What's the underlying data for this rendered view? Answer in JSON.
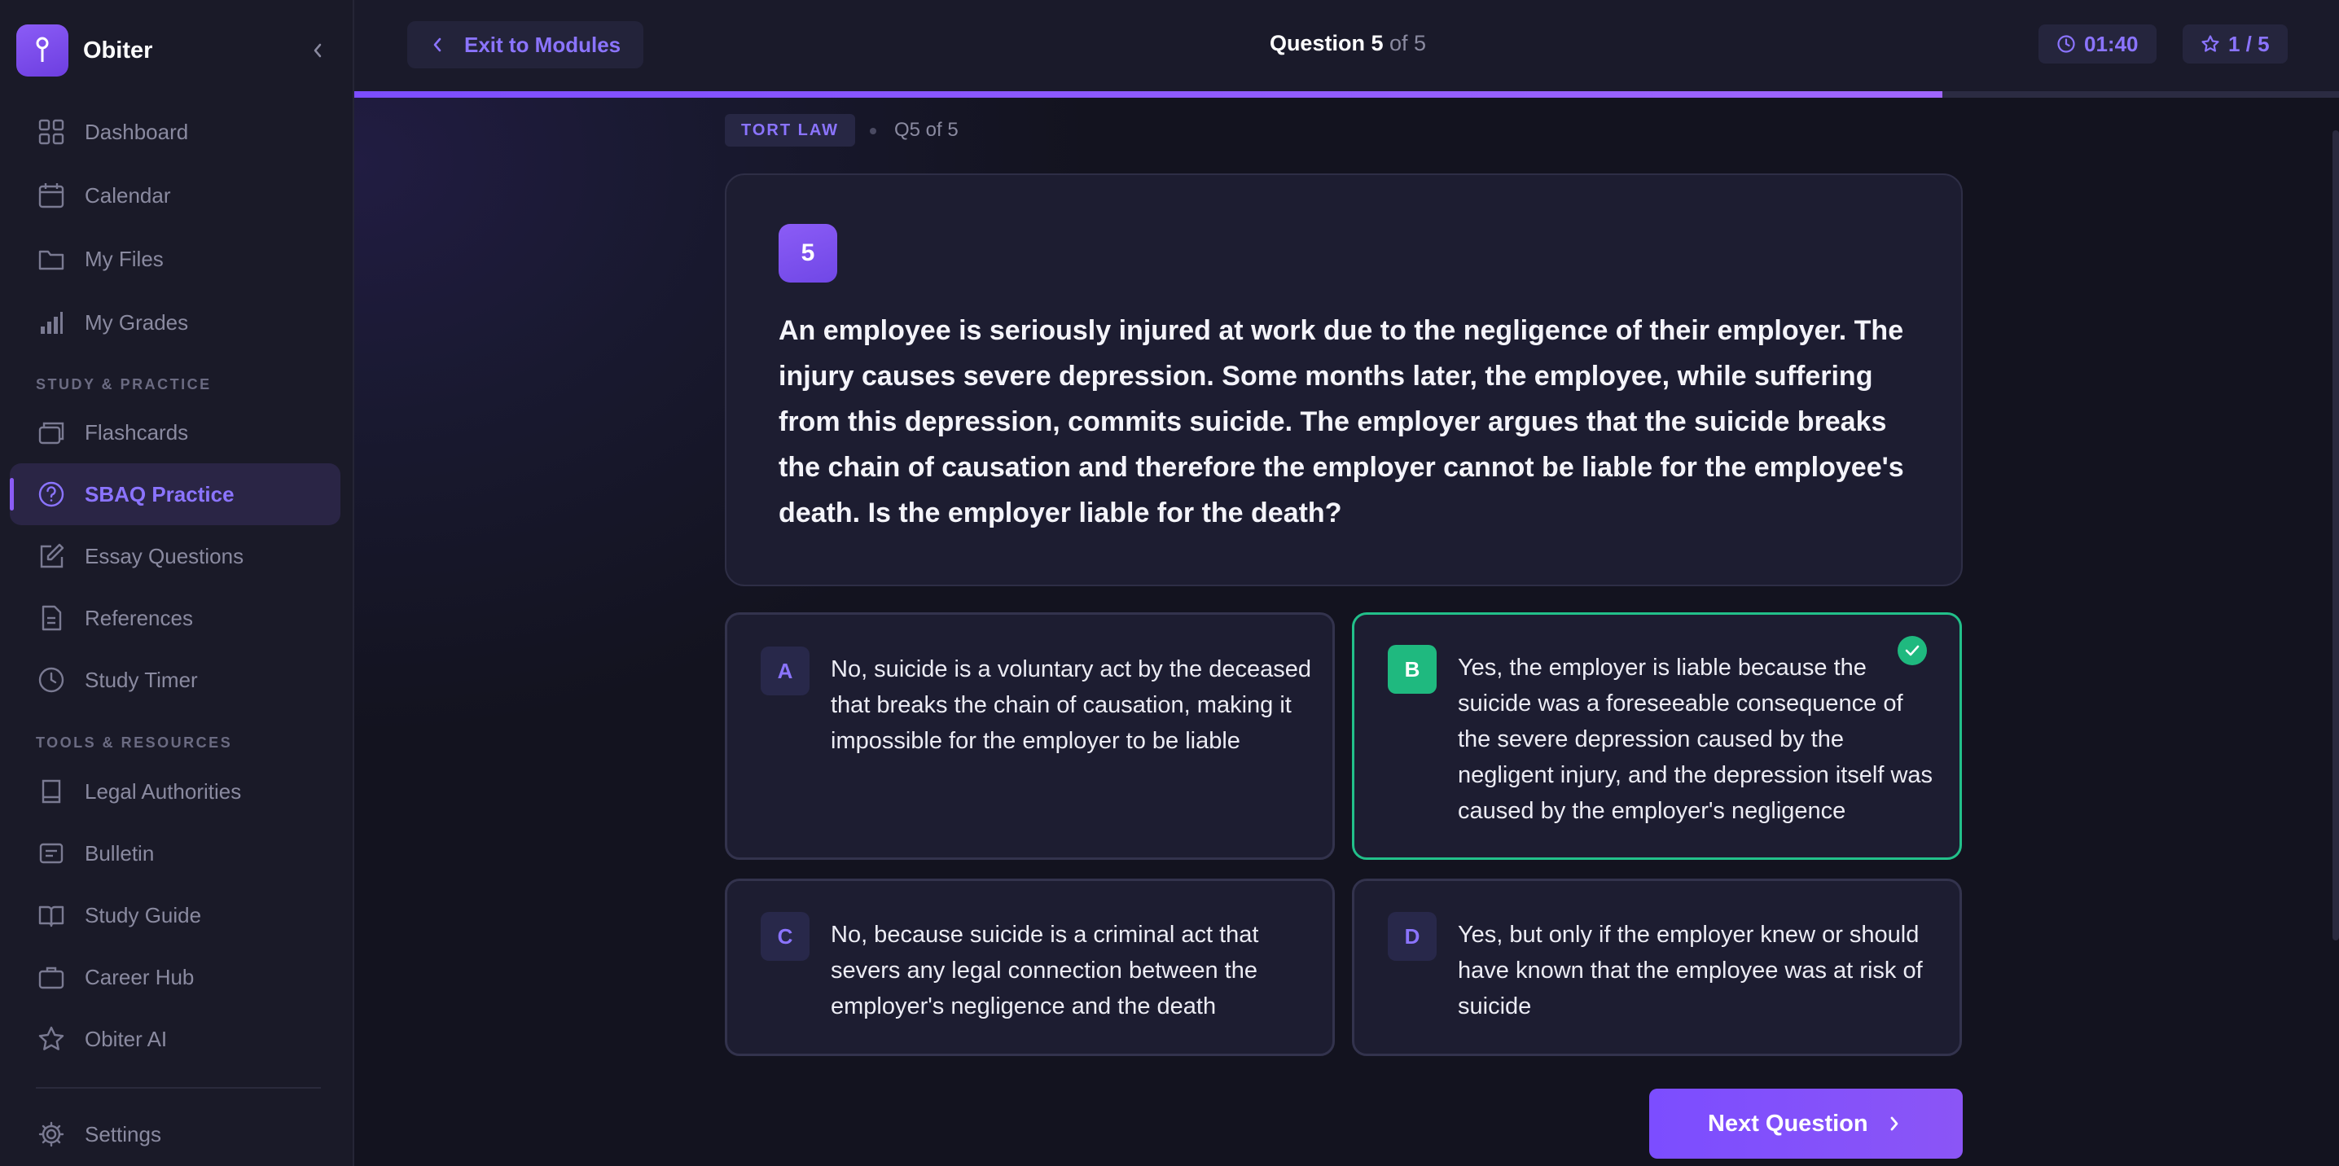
{
  "app": {
    "name": "Obiter"
  },
  "sidebar": {
    "main_items": [
      {
        "label": "Dashboard",
        "icon": "grid-icon"
      },
      {
        "label": "Calendar",
        "icon": "calendar-icon"
      },
      {
        "label": "My Files",
        "icon": "folder-icon"
      },
      {
        "label": "My Grades",
        "icon": "bar-chart-icon"
      }
    ],
    "section_study": "STUDY & PRACTICE",
    "study_items": [
      {
        "label": "Flashcards",
        "icon": "cards-icon"
      },
      {
        "label": "SBAQ Practice",
        "icon": "question-circle-icon",
        "active": true
      },
      {
        "label": "Essay Questions",
        "icon": "edit-icon"
      },
      {
        "label": "References",
        "icon": "document-icon"
      },
      {
        "label": "Study Timer",
        "icon": "clock-icon"
      }
    ],
    "section_tools": "TOOLS & RESOURCES",
    "tools_items": [
      {
        "label": "Legal Authorities",
        "icon": "book-icon"
      },
      {
        "label": "Bulletin",
        "icon": "bulletin-icon"
      },
      {
        "label": "Study Guide",
        "icon": "open-book-icon"
      },
      {
        "label": "Career Hub",
        "icon": "briefcase-icon"
      },
      {
        "label": "Obiter AI",
        "icon": "star-icon"
      }
    ],
    "settings": {
      "label": "Settings",
      "icon": "gear-icon"
    }
  },
  "topbar": {
    "exit_label": "Exit to Modules",
    "question_word": "Question",
    "question_current": "5",
    "question_total_text": "of 5",
    "timer": "01:40",
    "score": "1 / 5"
  },
  "progress": {
    "fraction": 0.8
  },
  "question": {
    "subject_tag": "TORT LAW",
    "position": "Q5 of 5",
    "number": "5",
    "text": "An employee is seriously injured at work due to the negligence of their employer. The injury causes severe depression. Some months later, the employee, while suffering from this depression, commits suicide. The employer argues that the suicide breaks the chain of causation and therefore the employer cannot be liable for the employee's death. Is the employer liable for the death?"
  },
  "options": [
    {
      "letter": "A",
      "text": "No, suicide is a voluntary act by the deceased that breaks the chain of causation, making it impossible for the employer to be liable",
      "selected": false
    },
    {
      "letter": "B",
      "text": "Yes, the employer is liable because the suicide was a foreseeable consequence of the severe depression caused by the negligent injury, and the depression itself was caused by the employer's negligence",
      "selected": true
    },
    {
      "letter": "C",
      "text": "No, because suicide is a criminal act that severs any legal connection between the employer's negligence and the death",
      "selected": false
    },
    {
      "letter": "D",
      "text": "Yes, but only if the employer knew or should have known that the employee was at risk of suicide",
      "selected": false
    }
  ],
  "actions": {
    "next_label": "Next Question"
  },
  "colors": {
    "accent": "#8b5cf6",
    "correct": "#1fb97f",
    "sidebar_bg": "#1a1a28"
  }
}
